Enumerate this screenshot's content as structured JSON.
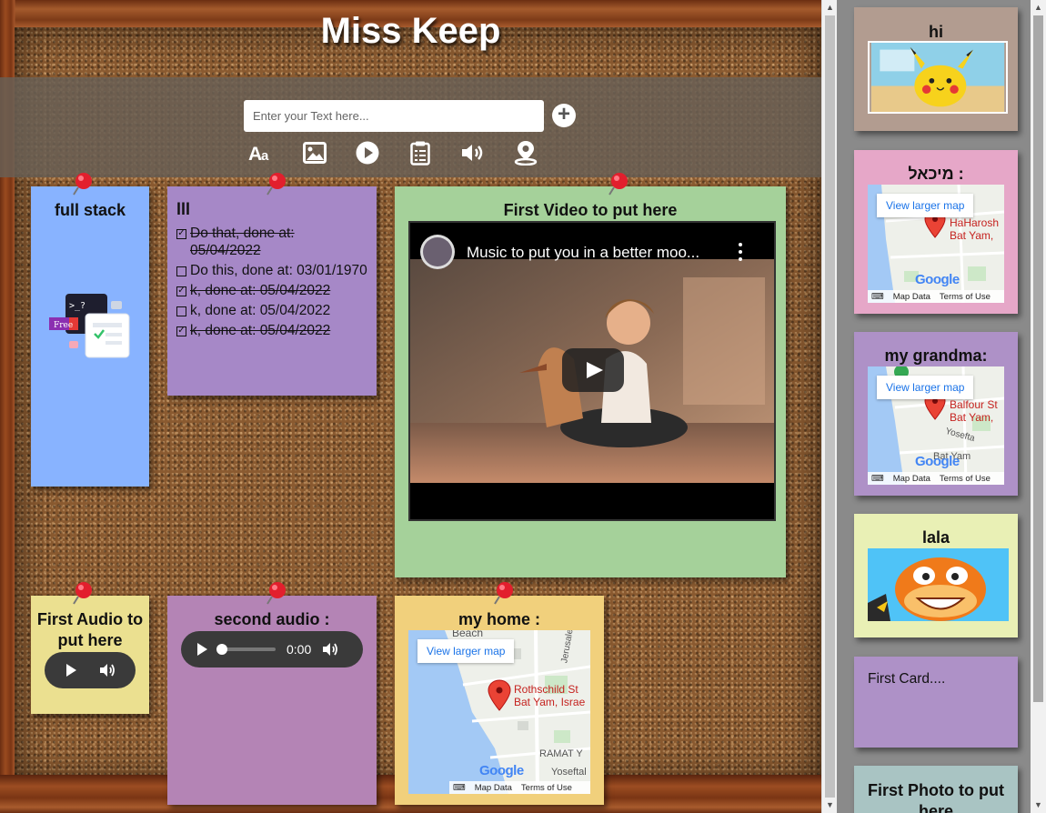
{
  "app": {
    "title": "Miss Keep"
  },
  "input": {
    "placeholder": "Enter your Text here...",
    "add_icon": "plus-circle-icon"
  },
  "tools": [
    {
      "name": "text",
      "icon": "text-icon"
    },
    {
      "name": "image",
      "icon": "image-icon"
    },
    {
      "name": "video",
      "icon": "play-icon"
    },
    {
      "name": "todo",
      "icon": "clipboard-list-icon"
    },
    {
      "name": "audio",
      "icon": "volume-icon"
    },
    {
      "name": "map",
      "icon": "map-pin-icon"
    }
  ],
  "board_notes": {
    "full_stack": {
      "title": "full stack",
      "color": "#88b3ff",
      "badge": "Free"
    },
    "todo": {
      "title": "lll",
      "color": "#a688c7",
      "items": [
        {
          "text": "Do that, done at: 05/04/2022",
          "done": true
        },
        {
          "text": "Do this, done at: 03/01/1970",
          "done": false
        },
        {
          "text": "k, done at: 05/04/2022",
          "done": true
        },
        {
          "text": "k, done at: 05/04/2022",
          "done": false
        },
        {
          "text": "k, done at: 05/04/2022",
          "done": true
        }
      ]
    },
    "video": {
      "title": "First Video to put here",
      "color": "#a5d19a",
      "video_title": "Music to put you in a better moo..."
    },
    "audio1": {
      "title": "First Audio to put here",
      "color": "#ebe090"
    },
    "audio2": {
      "title": "second audio :",
      "color": "#b484b5",
      "time": "0:00"
    },
    "home": {
      "title": "my home :",
      "color": "#f1d07c",
      "map_button": "View larger map",
      "address_line1": "Rothschild St",
      "address_line2": "Bat Yam, Israe",
      "label_beach": "Beach",
      "label_ramat": "RAMAT Y",
      "label_yoseftal": "Yoseftal",
      "label_jerusalem": "Jerusale",
      "map_data": "Map Data",
      "terms": "Terms of Use",
      "google": "Google"
    }
  },
  "sidebar_notes": {
    "hi": {
      "title": "hi",
      "color": "#b29c90"
    },
    "michal": {
      "title": "מיכאל :",
      "color": "#e6a7c8",
      "map_button": "View larger map",
      "address_line1": "HaHarosh",
      "address_line2": "Bat Yam,",
      "map_data": "Map Data",
      "terms": "Terms of Use",
      "google": "Google"
    },
    "grandma": {
      "title": "my grandma:",
      "color": "#ae91c7",
      "map_button": "View larger map",
      "address_line1": "Balfour St",
      "address_line2": "Bat Yam,",
      "label_yoseftal": "Yosefta",
      "label_batyam": "Bat Yam",
      "map_data": "Map Data",
      "terms": "Terms of Use",
      "google": "Google"
    },
    "lala": {
      "title": "lala",
      "color": "#e9f0b5"
    },
    "first_card": {
      "text": "First Card....",
      "color": "#ae91c7"
    },
    "first_photo": {
      "title": "First Photo to put here",
      "color": "#a9c4c3"
    }
  }
}
